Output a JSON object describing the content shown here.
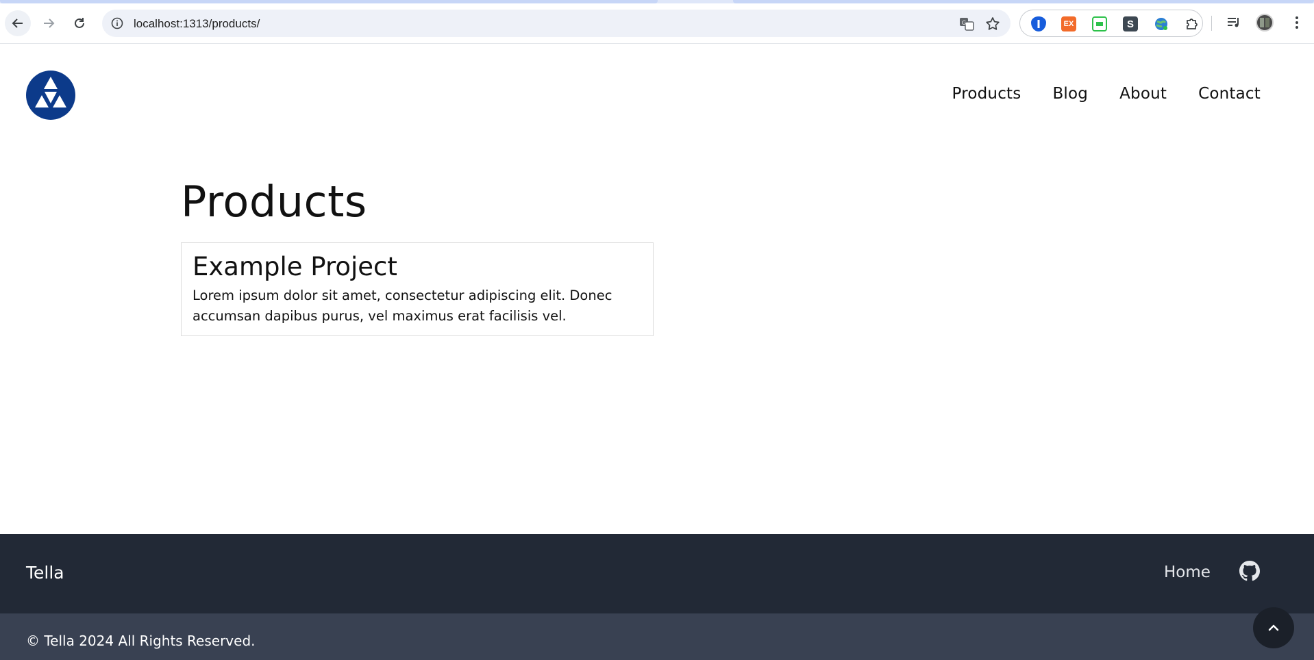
{
  "browser": {
    "url": "localhost:1313/products/",
    "icons": [
      "back-arrow-icon",
      "forward-arrow-icon",
      "reload-icon",
      "site-info-icon",
      "translate-icon",
      "star-icon",
      "bitwarden-icon",
      "ex-extension-icon",
      "green-extension-icon",
      "s-extension-icon",
      "globe-extension-icon",
      "extensions-puzzle-icon",
      "media-control-icon",
      "profile-avatar",
      "kebab-menu-icon"
    ],
    "ext_ex_label": "EX",
    "ext_s_label": "S"
  },
  "header": {
    "nav": [
      {
        "label": "Products"
      },
      {
        "label": "Blog"
      },
      {
        "label": "About"
      },
      {
        "label": "Contact"
      }
    ],
    "logo_color": "#0c3a8a"
  },
  "main": {
    "title": "Products",
    "cards": [
      {
        "title": "Example Project",
        "text": "Lorem ipsum dolor sit amet, consectetur adipiscing elit. Donec accumsan dapibus purus, vel maximus erat facilisis vel."
      }
    ]
  },
  "footer": {
    "brand": "Tella",
    "home_label": "Home",
    "copyright": "© Tella 2024 All Rights Reserved.",
    "colors": {
      "top": "#222936",
      "bottom": "#394152"
    }
  }
}
